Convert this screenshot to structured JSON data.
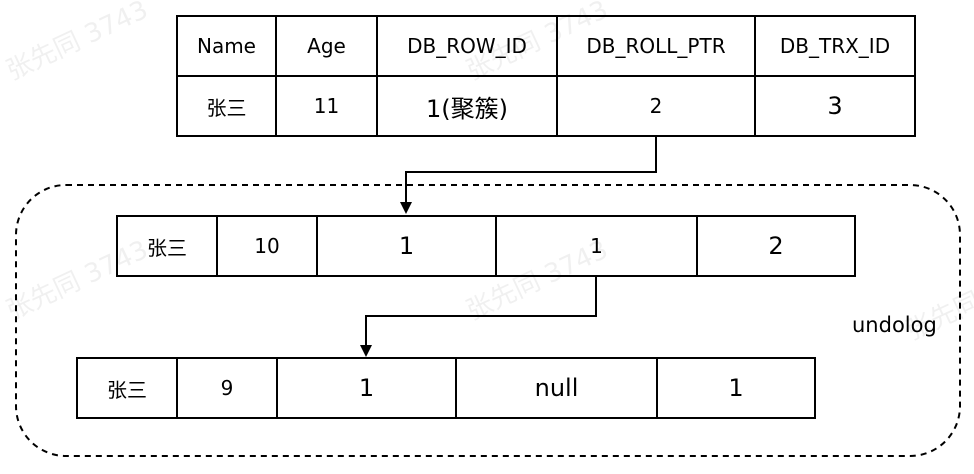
{
  "main_table": {
    "headers": [
      "Name",
      "Age",
      "DB_ROW_ID",
      "DB_ROLL_PTR",
      "DB_TRX_ID"
    ],
    "row": [
      "张三",
      "11",
      "1(聚簇)",
      "2",
      "3"
    ]
  },
  "undolog": {
    "label": "undolog",
    "records": [
      [
        "张三",
        "10",
        "1",
        "1",
        "2"
      ],
      [
        "张三",
        "9",
        "1",
        "null",
        "1"
      ]
    ]
  },
  "watermark": "张先同 3743"
}
